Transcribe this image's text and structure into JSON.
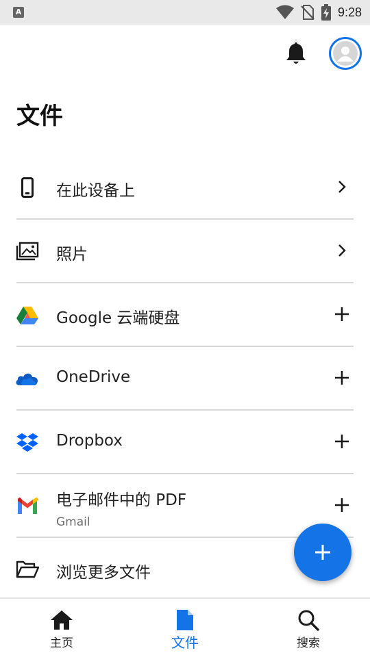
{
  "status_bar": {
    "app_badge": "A",
    "time": "9:28",
    "icons": [
      "wifi-icon",
      "no-sim-icon",
      "battery-charging-icon"
    ]
  },
  "header": {
    "icons": [
      "notification-bell-icon",
      "account-avatar-icon"
    ]
  },
  "page": {
    "title": "文件"
  },
  "locations": [
    {
      "icon": "phone-icon",
      "label": "在此设备上",
      "sublabel": "",
      "action": "chevron-right-icon"
    },
    {
      "icon": "photos-icon",
      "label": "照片",
      "sublabel": "",
      "action": "chevron-right-icon"
    },
    {
      "icon": "google-drive-icon",
      "label": "Google 云端硬盘",
      "sublabel": "",
      "action": "plus-icon"
    },
    {
      "icon": "onedrive-icon",
      "label": "OneDrive",
      "sublabel": "",
      "action": "plus-icon"
    },
    {
      "icon": "dropbox-icon",
      "label": "Dropbox",
      "sublabel": "",
      "action": "plus-icon"
    },
    {
      "icon": "gmail-icon",
      "label": "电子邮件中的 PDF",
      "sublabel": "Gmail",
      "action": "plus-icon"
    },
    {
      "icon": "folder-open-icon",
      "label": "浏览更多文件",
      "sublabel": "",
      "action": ""
    }
  ],
  "fab": {
    "icon": "plus-icon"
  },
  "bottom_nav": {
    "items": [
      {
        "icon": "home-icon",
        "label": "主页",
        "active": false
      },
      {
        "icon": "file-icon",
        "label": "文件",
        "active": true
      },
      {
        "icon": "search-icon",
        "label": "搜索",
        "active": false
      }
    ]
  },
  "colors": {
    "accent": "#1473e6",
    "status_bar_bg": "#e9e9e9",
    "divider": "#d8d8d8",
    "secondary_text": "#6e6e6e"
  }
}
